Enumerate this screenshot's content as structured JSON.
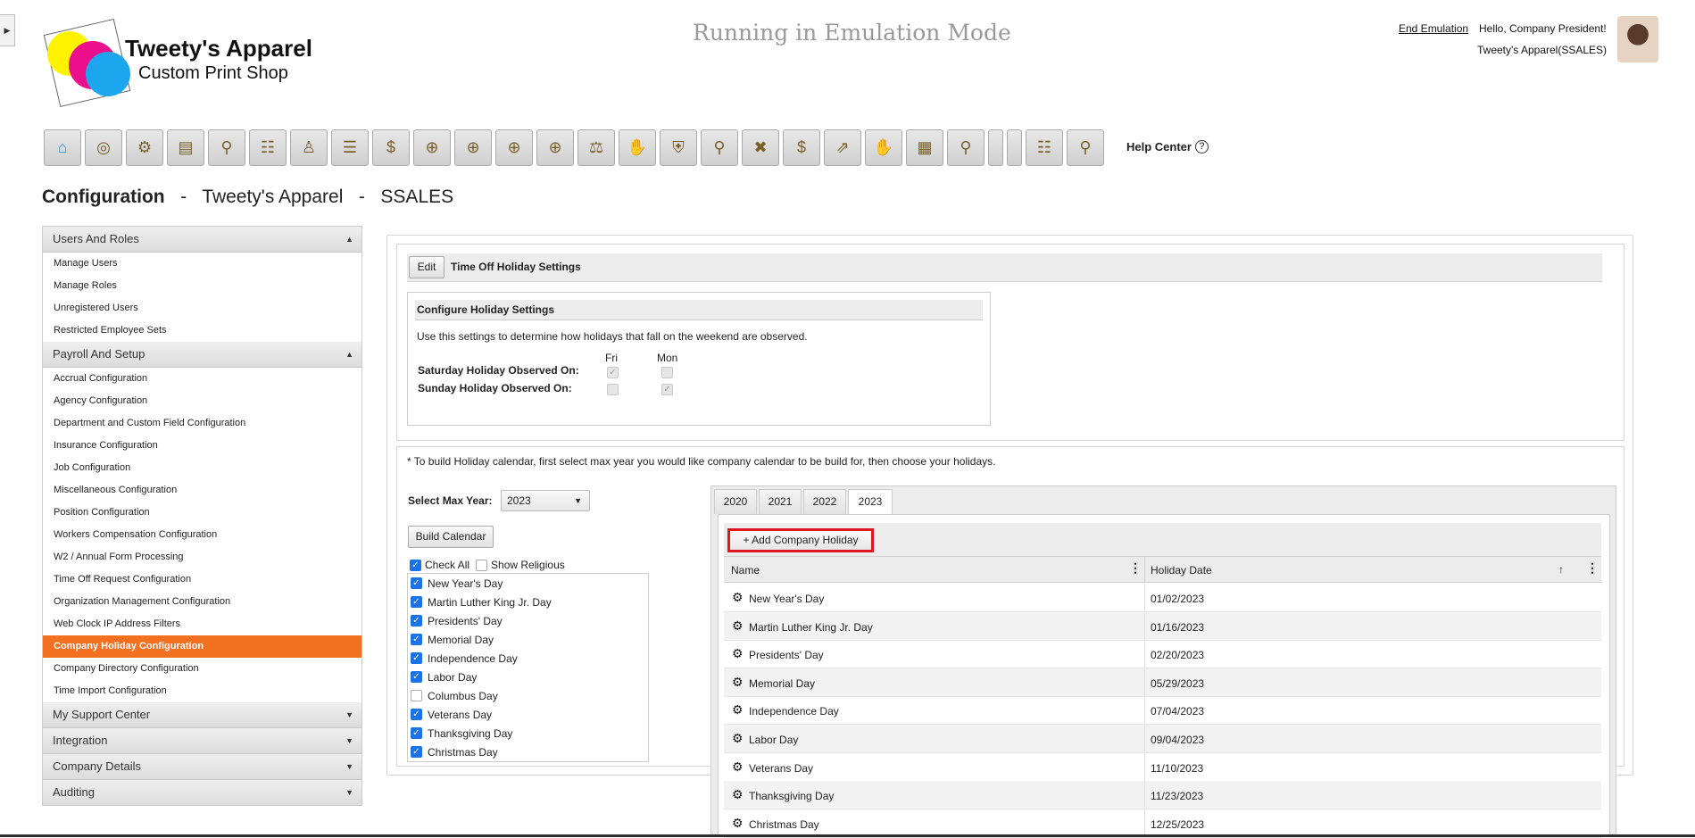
{
  "header": {
    "brand_name": "Tweety's Apparel",
    "brand_tagline": "Custom Print Shop",
    "emulation_notice": "Running in Emulation Mode",
    "end_emulation": "End Emulation",
    "greeting": "Hello, Company President!",
    "company_code": "Tweety's Apparel(SSALES)"
  },
  "toolbar": {
    "icons": [
      "home-icon",
      "dashboard-icon",
      "settings-people-icon",
      "presentation-icon",
      "team-search-icon",
      "org-chart-icon",
      "hierarchy-icon",
      "document-icon",
      "money-bag-icon",
      "target-icon",
      "target-icon",
      "target-icon",
      "target-icon",
      "scale-person-icon",
      "hand-card-icon",
      "shield-icon",
      "doc-search-icon",
      "person-remove-icon",
      "money-bag-icon",
      "team-growth-icon",
      "hand-card-icon",
      "team-board-icon",
      "doc-search-icon",
      "blank-icon",
      "blank-icon",
      "org-board-icon",
      "person-search-icon"
    ],
    "help_label": "Help Center",
    "help_icon": "?"
  },
  "page_title": {
    "section": "Configuration",
    "sep1": "-",
    "company": "Tweety's Apparel",
    "sep2": "-",
    "code": "SSALES"
  },
  "sidebar": {
    "sections": [
      {
        "label": "Users And Roles",
        "expanded": true,
        "items": [
          "Manage Users",
          "Manage Roles",
          "Unregistered Users",
          "Restricted Employee Sets"
        ]
      },
      {
        "label": "Payroll And Setup",
        "expanded": true,
        "items": [
          "Accrual Configuration",
          "Agency Configuration",
          "Department and Custom Field Configuration",
          "Insurance Configuration",
          "Job Configuration",
          "Miscellaneous Configuration",
          "Position Configuration",
          "Workers Compensation Configuration",
          "W2 / Annual Form Processing",
          "Time Off Request Configuration",
          "Organization Management Configuration",
          "Web Clock IP Address Filters",
          "Company Holiday Configuration",
          "Company Directory Configuration",
          "Time Import Configuration"
        ]
      },
      {
        "label": "My Support Center",
        "expanded": false,
        "items": []
      },
      {
        "label": "Integration",
        "expanded": false,
        "items": []
      },
      {
        "label": "Company Details",
        "expanded": false,
        "items": []
      },
      {
        "label": "Auditing",
        "expanded": false,
        "items": []
      }
    ],
    "active_item": "Company Holiday Configuration",
    "active_color": "#f37021"
  },
  "settings": {
    "edit_label": "Edit",
    "panel_title": "Time Off Holiday Settings",
    "box_title": "Configure Holiday Settings",
    "description": "Use this settings to determine how holidays that fall on the weekend are observed.",
    "col_fri": "Fri",
    "col_mon": "Mon",
    "saturday_label": "Saturday Holiday Observed On:",
    "sunday_label": "Sunday Holiday Observed On:",
    "saturday": {
      "fri": true,
      "mon": false
    },
    "sunday": {
      "fri": false,
      "mon": true
    }
  },
  "calendar": {
    "note": "* To build Holiday calendar, first select max year you would like company calendar to be build for, then choose your holidays.",
    "max_year_label": "Select Max Year:",
    "max_year_value": "2023",
    "build_label": "Build Calendar",
    "check_all_label": "Check All",
    "check_all": true,
    "show_religious_label": "Show Religious",
    "show_religious": false,
    "holidays": [
      {
        "name": "New Year's Day",
        "checked": true
      },
      {
        "name": "Martin Luther King Jr. Day",
        "checked": true
      },
      {
        "name": "Presidents' Day",
        "checked": true
      },
      {
        "name": "Memorial Day",
        "checked": true
      },
      {
        "name": "Independence Day",
        "checked": true
      },
      {
        "name": "Labor Day",
        "checked": true
      },
      {
        "name": "Columbus Day",
        "checked": false
      },
      {
        "name": "Veterans Day",
        "checked": true
      },
      {
        "name": "Thanksgiving Day",
        "checked": true
      },
      {
        "name": "Christmas Day",
        "checked": true
      }
    ]
  },
  "grid": {
    "tabs": [
      "2020",
      "2021",
      "2022",
      "2023"
    ],
    "selected_tab": "2023",
    "add_label": "Add Company Holiday",
    "add_icon": "+",
    "col_name": "Name",
    "col_date": "Holiday Date",
    "sort_icon": "↑",
    "rows": [
      {
        "name": "New Year's Day",
        "date": "01/02/2023"
      },
      {
        "name": "Martin Luther King Jr. Day",
        "date": "01/16/2023"
      },
      {
        "name": "Presidents' Day",
        "date": "02/20/2023"
      },
      {
        "name": "Memorial Day",
        "date": "05/29/2023"
      },
      {
        "name": "Independence Day",
        "date": "07/04/2023"
      },
      {
        "name": "Labor Day",
        "date": "09/04/2023"
      },
      {
        "name": "Veterans Day",
        "date": "11/10/2023"
      },
      {
        "name": "Thanksgiving Day",
        "date": "11/23/2023"
      },
      {
        "name": "Christmas Day",
        "date": "12/25/2023"
      }
    ]
  }
}
